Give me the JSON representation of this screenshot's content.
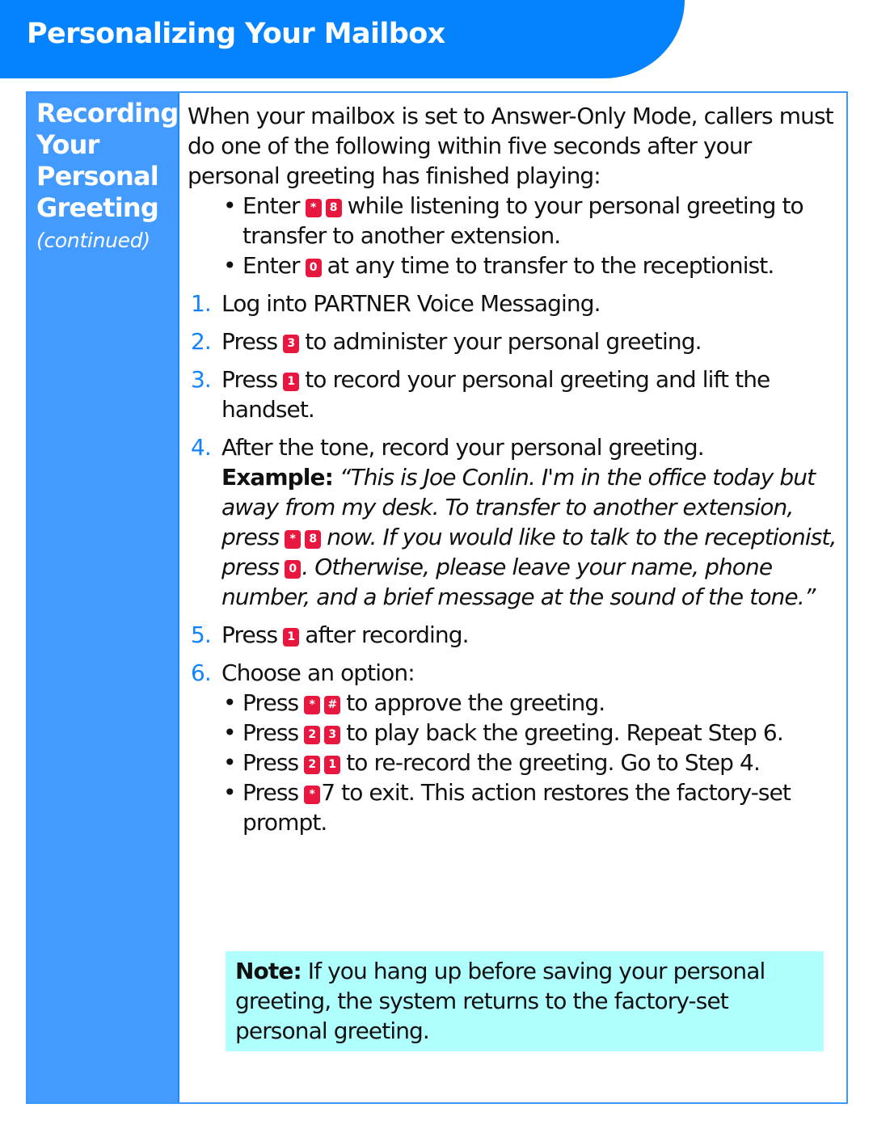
{
  "header": {
    "title": "Personalizing Your Mailbox"
  },
  "colors": {
    "banner": "#0583ff",
    "sidebar": "#439bff",
    "key": "#e8173f",
    "step_number": "#1283ff",
    "note_bg": "#b0ffff"
  },
  "sidebar": {
    "title": "Recording Your Personal Greeting",
    "subtitle": "(continued)"
  },
  "intro": {
    "text": "When your mailbox is set to Answer-Only Mode, callers must do one of the following within five seconds after your personal greeting has finished playing:",
    "bullets": [
      {
        "pre": "Enter",
        "keys": [
          "*",
          "8"
        ],
        "post": "while listening to your personal greeting to transfer to another extension."
      },
      {
        "pre": "Enter",
        "keys": [
          "0"
        ],
        "post": "at any time to transfer to the receptionist."
      }
    ]
  },
  "steps": [
    {
      "num": "1.",
      "text": "Log into PARTNER Voice Messaging."
    },
    {
      "num": "2.",
      "pre": "Press",
      "keys": [
        "3"
      ],
      "post": "to administer your personal greeting."
    },
    {
      "num": "3.",
      "pre": "Press",
      "keys": [
        "1"
      ],
      "post": "to record your personal greeting and lift the handset."
    },
    {
      "num": "4.",
      "text": "After the tone, record your personal greeting.",
      "example_label": "Example:",
      "example_part1": "“This is Joe Conlin. I'm in the office today but away from my desk. To transfer to another extension, press",
      "example_keys1": [
        "*",
        "8"
      ],
      "example_part2": "now. If you would like to talk to the receptionist, press",
      "example_keys2": [
        "0"
      ],
      "example_part3": ". Otherwise, please leave your name, phone number, and a brief message at the sound of the tone.”"
    },
    {
      "num": "5.",
      "pre": "Press",
      "keys": [
        "1"
      ],
      "post": "after recording."
    },
    {
      "num": "6.",
      "text": "Choose an option:",
      "options": [
        {
          "pre": "Press",
          "keys": [
            "*",
            "#"
          ],
          "post": "to approve the greeting."
        },
        {
          "pre": "Press",
          "keys": [
            "2",
            "3"
          ],
          "post": "to play back the greeting. Repeat Step 6."
        },
        {
          "pre": "Press",
          "keys": [
            "2",
            "1"
          ],
          "post": "to re-record the greeting. Go to Step 4."
        },
        {
          "pre": "Press",
          "keys": [
            "*"
          ],
          "post": "7 to exit. This action restores the factory-set prompt."
        }
      ]
    }
  ],
  "note": {
    "label": "Note:",
    "text": "If you hang up before saving your personal greeting, the system returns to the factory-set personal greeting."
  }
}
